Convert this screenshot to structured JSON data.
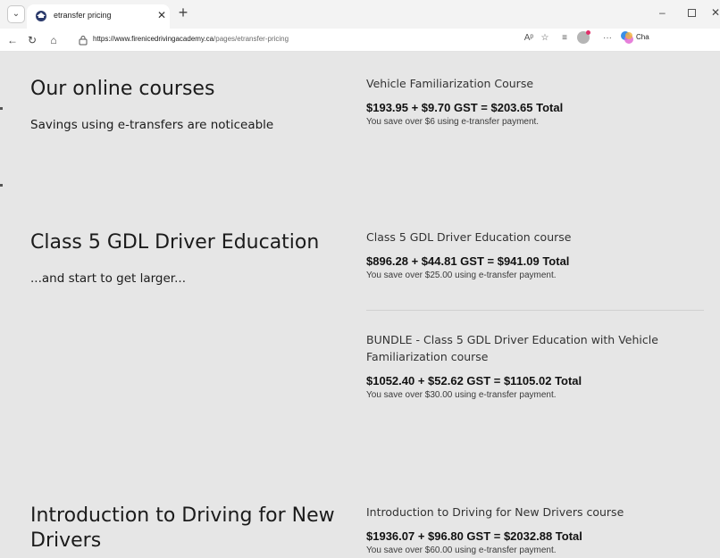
{
  "browser": {
    "tab": {
      "title": "etransfer pricing"
    },
    "url": {
      "host": "https://www.firenicedrivingacademy.ca",
      "path": "/pages/etransfer-pricing"
    },
    "copilot_label": "Cha"
  },
  "sections": [
    {
      "title": "Our online courses",
      "subtitle": "Savings using e-transfers are noticeable",
      "courses": [
        {
          "name": "Vehicle Familiarization Course",
          "price": "$193.95 + $9.70 GST = $203.65 Total",
          "savings": "You save over $6 using e-transfer payment."
        }
      ]
    },
    {
      "title": "Class 5 GDL Driver Education",
      "subtitle": "...and start to get larger...",
      "courses": [
        {
          "name": "Class 5 GDL Driver Education course",
          "price": "$896.28 + $44.81 GST = $941.09 Total",
          "savings": "You save over $25.00 using e-transfer payment."
        },
        {
          "name": "BUNDLE - Class 5 GDL Driver Education with Vehicle Familiarization course",
          "price": "$1052.40 + $52.62 GST = $1105.02 Total",
          "savings": "You save over $30.00 using e-transfer payment."
        }
      ]
    },
    {
      "title": "Introduction to Driving for New Drivers",
      "courses": [
        {
          "name": "Introduction to Driving for New Drivers course",
          "price": "$1936.07 + $96.80 GST = $2032.88 Total",
          "savings": "You save over $60.00 using e-transfer payment."
        }
      ]
    }
  ]
}
